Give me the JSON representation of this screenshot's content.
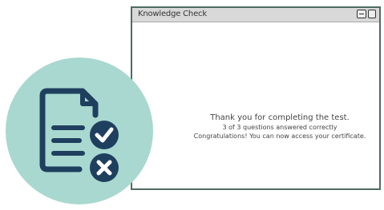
{
  "window": {
    "title": "Knowledge Check"
  },
  "message": {
    "line1": "Thank you for completing the test.",
    "line2": "3 of 3 questions answered correctly",
    "line3": "Congratulations! You can now access your certificate."
  },
  "colors": {
    "badge_bg": "#a8d8cf",
    "icon_color": "#1f3f5f",
    "window_border": "#4f6b5f"
  },
  "icons": {
    "badge": "document-check-cross-icon"
  }
}
